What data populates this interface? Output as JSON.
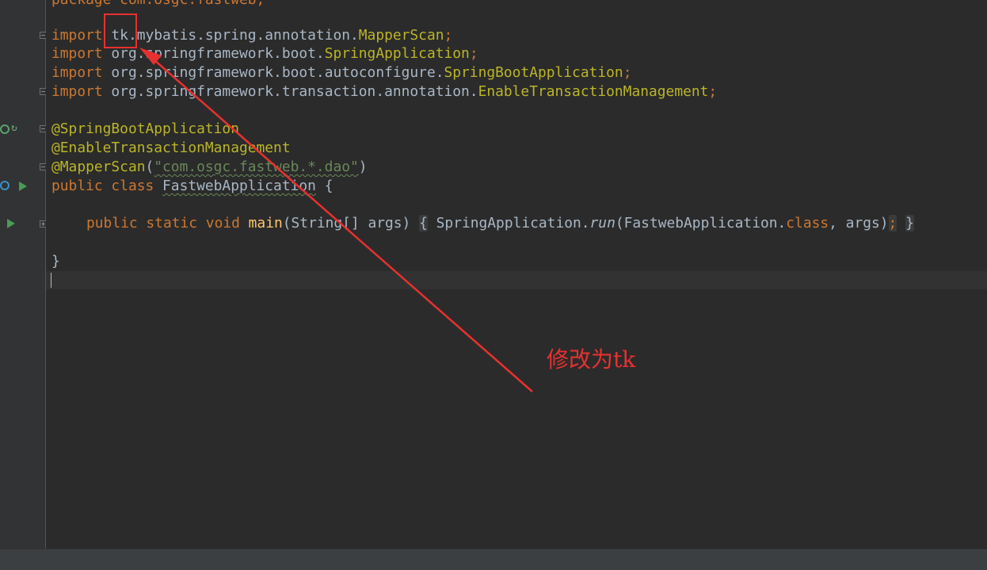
{
  "code": {
    "package_line": "package com.osgc.fastweb;",
    "import1": {
      "kw": "import",
      "pkg": " tk.mybatis.spring.annotation.",
      "cls": "MapperScan",
      "end": ";"
    },
    "import2": {
      "kw": "import",
      "pkg": " org.springframework.boot.",
      "cls": "SpringApplication",
      "end": ";"
    },
    "import3": {
      "kw": "import",
      "pkg": " org.springframework.boot.autoconfigure.",
      "cls": "SpringBootApplication",
      "end": ";"
    },
    "import4": {
      "kw": "import",
      "pkg": " org.springframework.transaction.annotation.",
      "cls": "EnableTransactionManagement",
      "end": ";"
    },
    "annotation1": "@SpringBootApplication",
    "annotation2": "@EnableTransactionManagement",
    "annotation3": {
      "name": "@MapperScan",
      "open": "(",
      "str": "\"com.osgc.fastweb.*.dao\"",
      "close": ")"
    },
    "class_decl": {
      "kw": "public class ",
      "name": "FastwebApplication",
      "rest": " {"
    },
    "main_line": {
      "kw": "public static void ",
      "fn": "main",
      "params": "(String[] args) ",
      "brace_open": "{",
      "body1": " SpringApplication.",
      "run": "run",
      "body2": "(FastwebApplication.",
      "class_kw": "class",
      "body3": ", args)",
      "semi": ";",
      "brace_close": "}"
    },
    "close_brace": "}"
  },
  "annotation_overlay": {
    "note": "修改为tk",
    "color": "#e8312f"
  },
  "colors": {
    "background": "#2b2b2b",
    "keyword": "#cc7832",
    "class_ref": "#bbb529",
    "string": "#6a8759",
    "function": "#ffc66d",
    "text": "#a9b7c6"
  }
}
